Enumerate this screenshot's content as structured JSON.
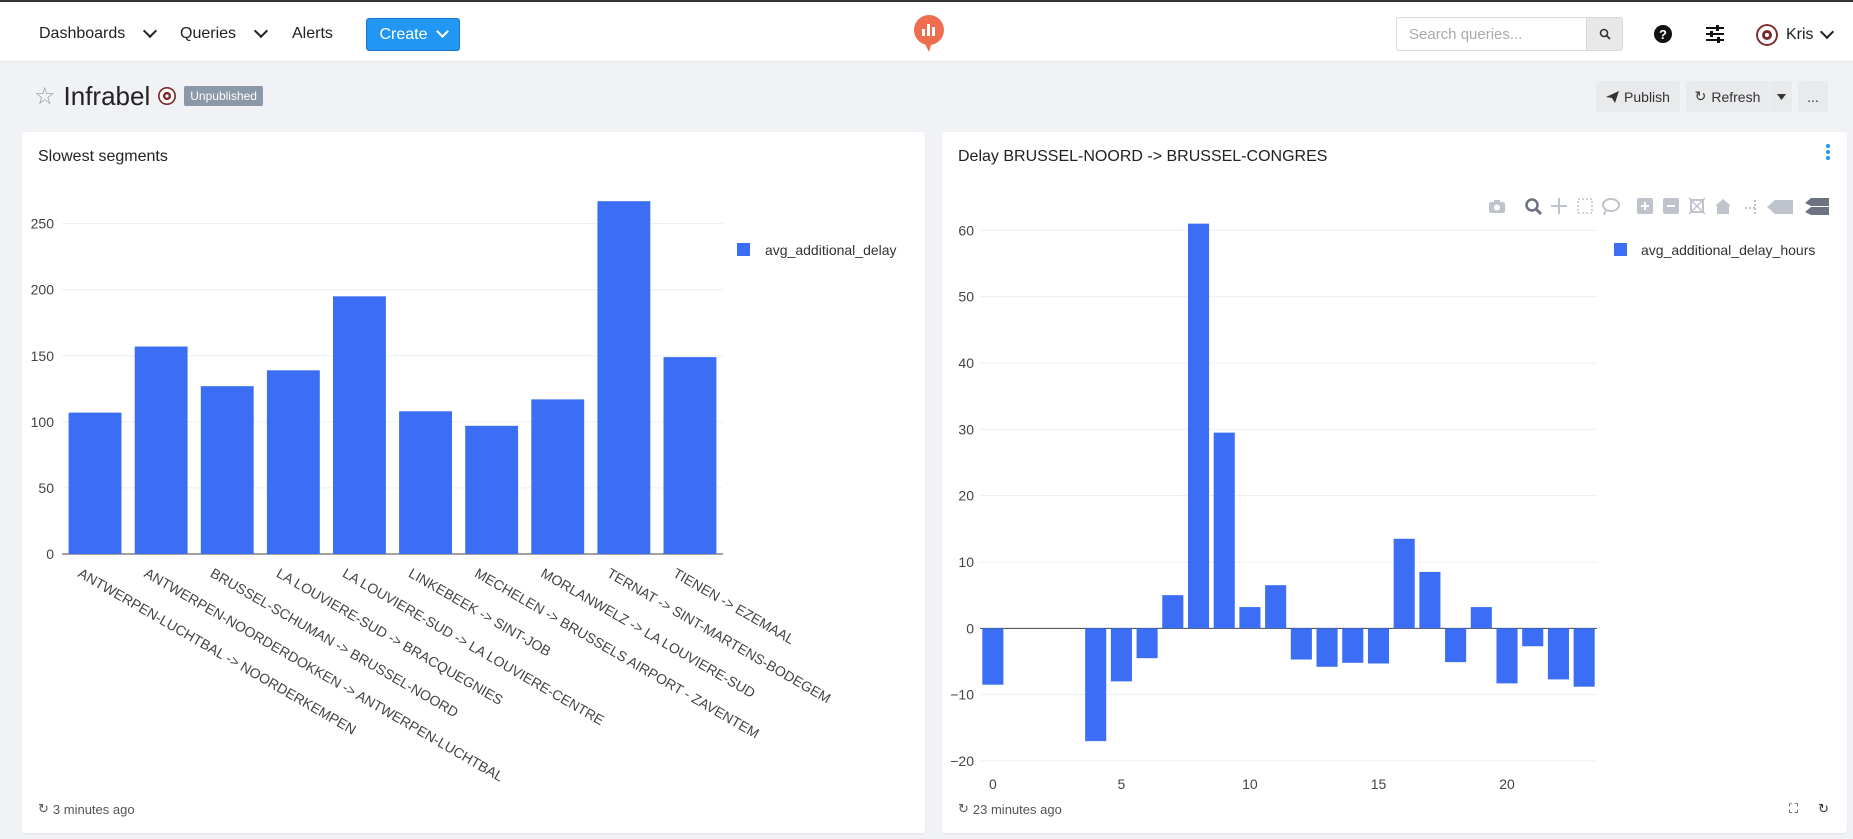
{
  "nav": {
    "dashboards": "Dashboards",
    "queries": "Queries",
    "alerts": "Alerts",
    "create": "Create"
  },
  "search": {
    "placeholder": "Search queries..."
  },
  "user": {
    "name": "Kris"
  },
  "dashboard": {
    "title": "Infrabel",
    "status_badge": "Unpublished",
    "publish_label": "Publish",
    "refresh_label": "Refresh",
    "more_label": "..."
  },
  "widgets": [
    {
      "title": "Slowest segments",
      "updated": "3 minutes ago"
    },
    {
      "title": "Delay BRUSSEL-NOORD -> BRUSSEL-CONGRES",
      "updated": "23 minutes ago"
    }
  ],
  "colors": {
    "accent": "#2196f3",
    "bar": "#3b6ef5",
    "logo": "#ee6e4f"
  },
  "chart_data": [
    {
      "type": "bar",
      "categories": [
        "ANTWERPEN-LUCHTBAL -> NOORDERKEMPEN",
        "ANTWERPEN-NOORDERDOKKEN -> ANTWERPEN-LUCHTBAL",
        "BRUSSEL-SCHUMAN -> BRUSSEL-NOORD",
        "LA LOUVIERE-SUD -> BRACQUEGNIES",
        "LA LOUVIERE-SUD -> LA LOUVIERE-CENTRE",
        "LINKEBEEK -> SINT-JOB",
        "MECHELEN -> BRUSSELS AIRPORT - ZAVENTEM",
        "MORLANWELZ -> LA LOUVIERE-SUD",
        "TERNAT -> SINT-MARTENS-BODEGEM",
        "TIENEN -> EZEMAAL"
      ],
      "series": [
        {
          "name": "avg_additional_delay",
          "values": [
            107,
            157,
            127,
            139,
            195,
            108,
            97,
            117,
            267,
            149
          ]
        }
      ],
      "yticks": [
        0,
        50,
        100,
        150,
        200,
        250
      ],
      "ylim": [
        0,
        280
      ],
      "legend": "top-right",
      "grid": true
    },
    {
      "type": "bar",
      "x": [
        0,
        1,
        2,
        3,
        4,
        5,
        6,
        7,
        8,
        9,
        10,
        11,
        12,
        13,
        14,
        15,
        16,
        17,
        18,
        19,
        20,
        21,
        22,
        23
      ],
      "series": [
        {
          "name": "avg_additional_delay_hours",
          "values": [
            -8.5,
            0,
            0,
            0,
            -17,
            -8,
            -4.5,
            5,
            61,
            29.5,
            3.2,
            6.5,
            -4.7,
            -5.8,
            -5.2,
            -5.3,
            13.5,
            8.5,
            -5.1,
            3.2,
            -8.3,
            -2.7,
            -7.7,
            -8.8
          ]
        }
      ],
      "xticks": [
        0,
        5,
        10,
        15,
        20
      ],
      "yticks": [
        -20,
        -10,
        0,
        10,
        20,
        30,
        40,
        50,
        60
      ],
      "ylim": [
        -20,
        62
      ],
      "legend": "top-right",
      "grid": true
    }
  ]
}
